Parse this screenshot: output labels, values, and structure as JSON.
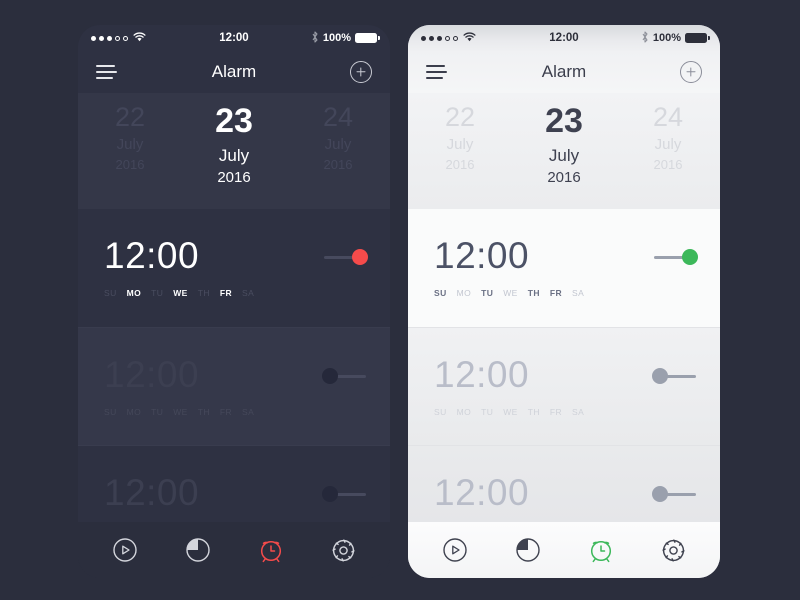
{
  "page": {
    "background_color": "#2b2e3d",
    "accent_dark": "#f54b4b",
    "accent_light": "#3cb85a"
  },
  "status_bar": {
    "signal_dots_filled": 3,
    "signal_dots_total": 5,
    "wifi_icon": "wifi-icon",
    "time": "12:00",
    "bluetooth_icon": "bluetooth-icon",
    "battery_percent": "100%",
    "battery_icon": "battery-full-icon"
  },
  "nav": {
    "menu_icon": "hamburger-menu-icon",
    "title": "Alarm",
    "add_icon": "plus-circle-icon"
  },
  "date_strip": {
    "previous": {
      "day": "22",
      "month": "July",
      "year": "2016"
    },
    "current": {
      "day": "23",
      "month": "July",
      "year": "2016"
    },
    "next": {
      "day": "24",
      "month": "July",
      "year": "2016"
    }
  },
  "day_labels": [
    "SU",
    "MO",
    "TU",
    "WE",
    "TH",
    "FR",
    "SA"
  ],
  "dark_theme": {
    "alarms": [
      {
        "time": "12:00",
        "enabled": true,
        "active_days": [
          "MO",
          "WE",
          "FR"
        ],
        "toggle_state": "on",
        "toggle_color": "#f54b4b"
      },
      {
        "time": "12:00",
        "enabled": false,
        "active_days": [],
        "toggle_state": "off",
        "toggle_color": "#25283a"
      },
      {
        "time": "12:00",
        "enabled": false,
        "active_days": [],
        "toggle_state": "off",
        "toggle_color": "#25283a"
      }
    ],
    "tabs": [
      {
        "name": "stopwatch",
        "icon": "play-circle-icon",
        "active": false
      },
      {
        "name": "timer",
        "icon": "pie-timer-icon",
        "active": false
      },
      {
        "name": "alarm",
        "icon": "alarm-clock-icon",
        "active": true
      },
      {
        "name": "settings",
        "icon": "gear-icon",
        "active": false
      }
    ]
  },
  "light_theme": {
    "alarms": [
      {
        "time": "12:00",
        "enabled": true,
        "active_days": [
          "SU",
          "TU",
          "TH",
          "FR"
        ],
        "toggle_state": "on",
        "toggle_color": "#3cb85a"
      },
      {
        "time": "12:00",
        "enabled": false,
        "active_days": [],
        "toggle_state": "off",
        "toggle_color": "#9aa0ad"
      },
      {
        "time": "12:00",
        "enabled": false,
        "active_days": [],
        "toggle_state": "off",
        "toggle_color": "#9aa0ad"
      }
    ],
    "tabs": [
      {
        "name": "stopwatch",
        "icon": "play-circle-icon",
        "active": false
      },
      {
        "name": "timer",
        "icon": "pie-timer-icon",
        "active": false
      },
      {
        "name": "alarm",
        "icon": "alarm-clock-icon",
        "active": true
      },
      {
        "name": "settings",
        "icon": "gear-icon",
        "active": false
      }
    ]
  }
}
